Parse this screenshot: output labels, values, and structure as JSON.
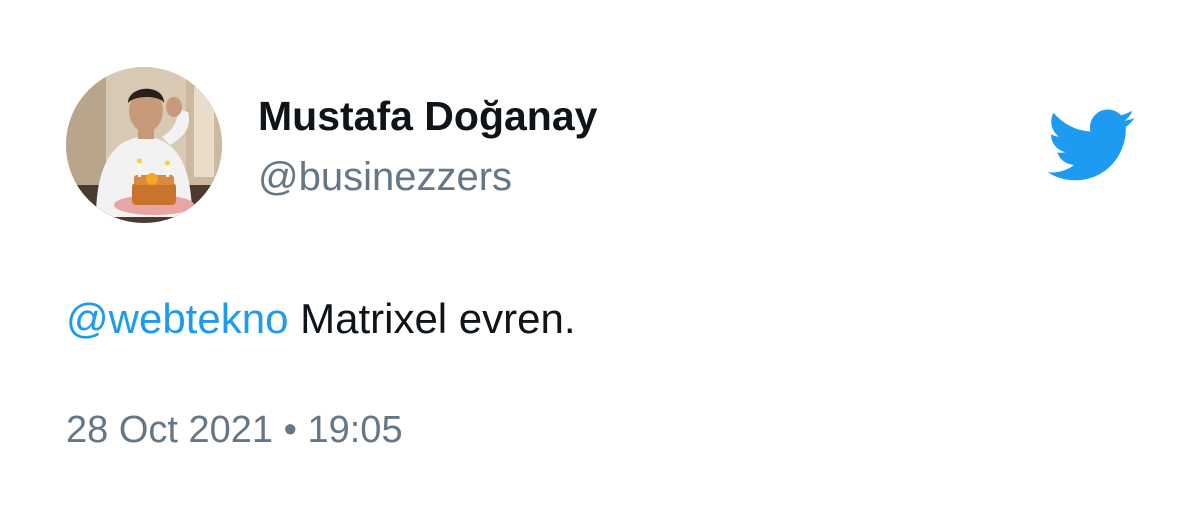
{
  "author": {
    "display_name": "Mustafa Doğanay",
    "username": "@businezzers",
    "avatar_icon": "profile-photo"
  },
  "tweet": {
    "mention": "@webtekno",
    "body": " Matrixel evren."
  },
  "meta": {
    "date": "28 Oct 2021",
    "separator": "•",
    "time": "19:05"
  },
  "brand": {
    "icon": "twitter-bird-icon",
    "accent_color": "#1d9bf0",
    "text_color": "#0f1419",
    "muted_color": "#657786"
  }
}
